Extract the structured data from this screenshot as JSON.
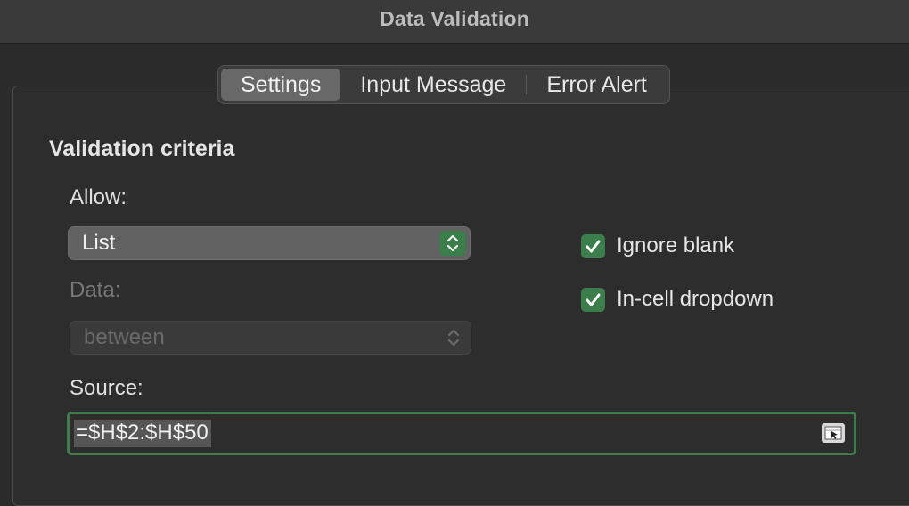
{
  "window": {
    "title": "Data Validation"
  },
  "tabs": [
    {
      "label": "Settings",
      "active": true
    },
    {
      "label": "Input Message",
      "active": false
    },
    {
      "label": "Error Alert",
      "active": false
    }
  ],
  "settings": {
    "section_title": "Validation criteria",
    "allow_label": "Allow:",
    "allow_value": "List",
    "data_label": "Data:",
    "data_value": "between",
    "source_label": "Source:",
    "source_value": "=$H$2:$H$50",
    "ignore_blank": {
      "label": "Ignore blank",
      "checked": true
    },
    "in_cell_dropdown": {
      "label": "In-cell dropdown",
      "checked": true
    }
  },
  "colors": {
    "accent_green": "#3b7d4b",
    "window_bg": "#2b2b2b"
  },
  "icons": {
    "stepper": "up-down-chevrons-icon",
    "checkmark": "checkmark-icon",
    "range_select": "collapse-dialog-icon"
  }
}
